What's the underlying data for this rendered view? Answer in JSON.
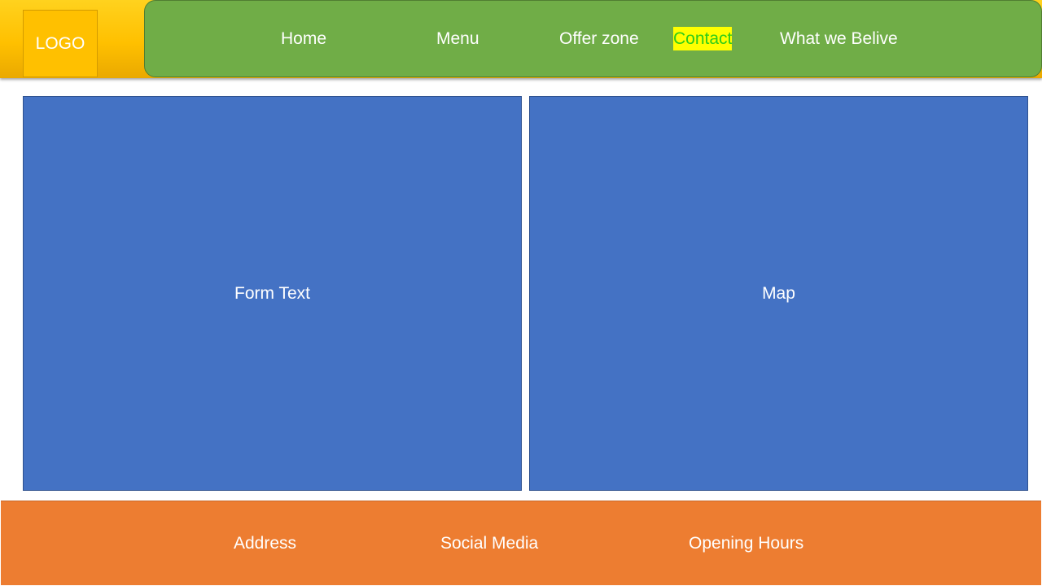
{
  "header": {
    "logo_text": "LOGO",
    "nav": [
      {
        "label": "Home"
      },
      {
        "label": "Menu"
      },
      {
        "label": "Offer zone"
      },
      {
        "label": "Contact",
        "active": true
      },
      {
        "label": "What we Belive"
      }
    ]
  },
  "main": {
    "left_panel_text": "Form Text",
    "right_panel_text": "Map"
  },
  "footer": {
    "items": [
      {
        "label": "Address"
      },
      {
        "label": "Social Media"
      },
      {
        "label": "Opening Hours"
      }
    ]
  },
  "colors": {
    "header_background": "#ffc000",
    "nav_background": "#70ad47",
    "panel_background": "#4472c4",
    "footer_background": "#ed7d31",
    "active_highlight": "#ffff00",
    "active_text": "#2ecc18"
  }
}
